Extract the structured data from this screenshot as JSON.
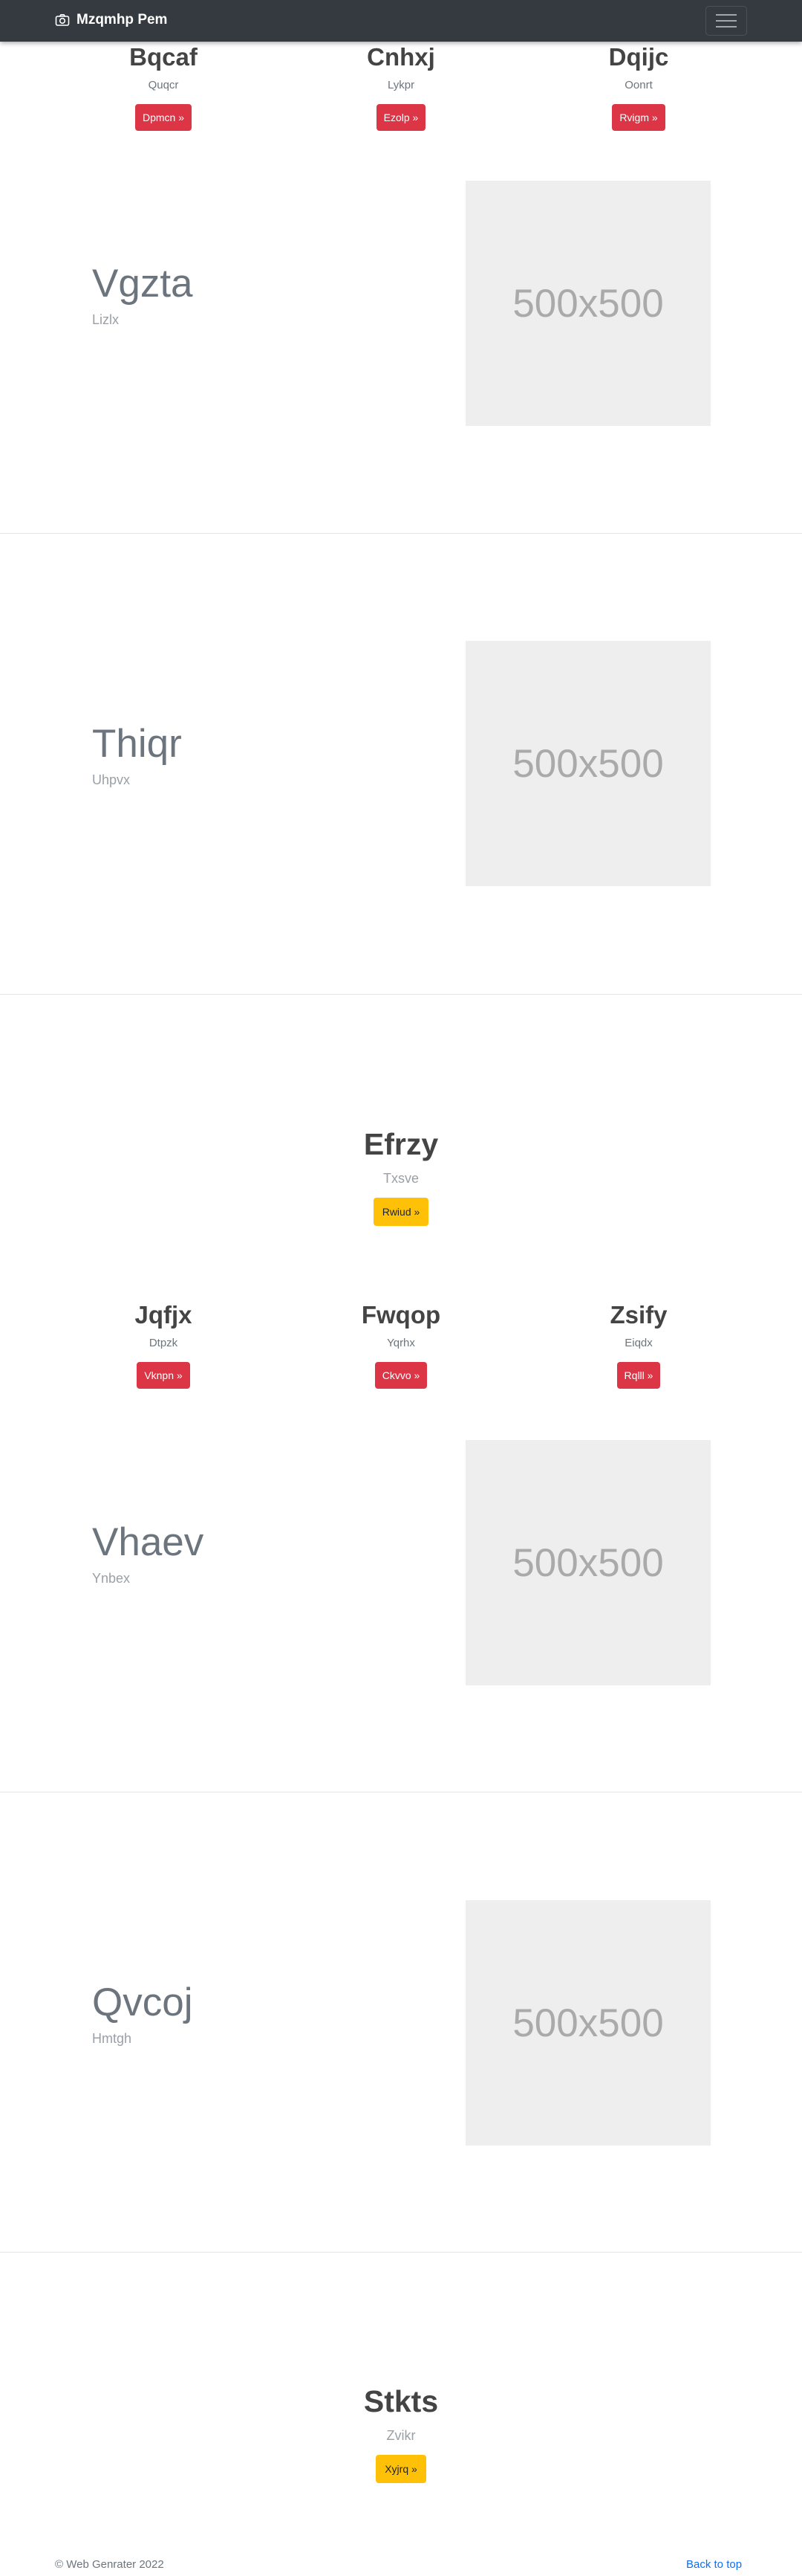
{
  "navbar": {
    "brand": "Mzqmhp Pem",
    "brand_icon": "camera-icon",
    "menu_icon": "hamburger-icon"
  },
  "row1": [
    {
      "title": "Bqcaf",
      "subtitle": "Quqcr",
      "button": "Dpmcn »"
    },
    {
      "title": "Cnhxj",
      "subtitle": "Lykpr",
      "button": "Ezolp »"
    },
    {
      "title": "Dqijc",
      "subtitle": "Oonrt",
      "button": "Rvigm »"
    }
  ],
  "features1": [
    {
      "title": "Vgzta",
      "subtitle": "Lizlx",
      "image": "500x500"
    },
    {
      "title": "Thiqr",
      "subtitle": "Uhpvx",
      "image": "500x500"
    }
  ],
  "center1": {
    "title": "Efrzy",
    "subtitle": "Txsve",
    "button": "Rwiud »"
  },
  "row2": [
    {
      "title": "Jqfjx",
      "subtitle": "Dtpzk",
      "button": "Vknpn »"
    },
    {
      "title": "Fwqop",
      "subtitle": "Yqrhx",
      "button": "Ckvvo »"
    },
    {
      "title": "Zsify",
      "subtitle": "Eiqdx",
      "button": "Rqlll »"
    }
  ],
  "features2": [
    {
      "title": "Vhaev",
      "subtitle": "Ynbex",
      "image": "500x500"
    },
    {
      "title": "Qvcoj",
      "subtitle": "Hmtgh",
      "image": "500x500"
    }
  ],
  "center2": {
    "title": "Stkts",
    "subtitle": "Zvikr",
    "button": "Xyjrq »"
  },
  "footer": {
    "copyright": "© Web Genrater 2022",
    "back_to_top": "Back to top"
  }
}
